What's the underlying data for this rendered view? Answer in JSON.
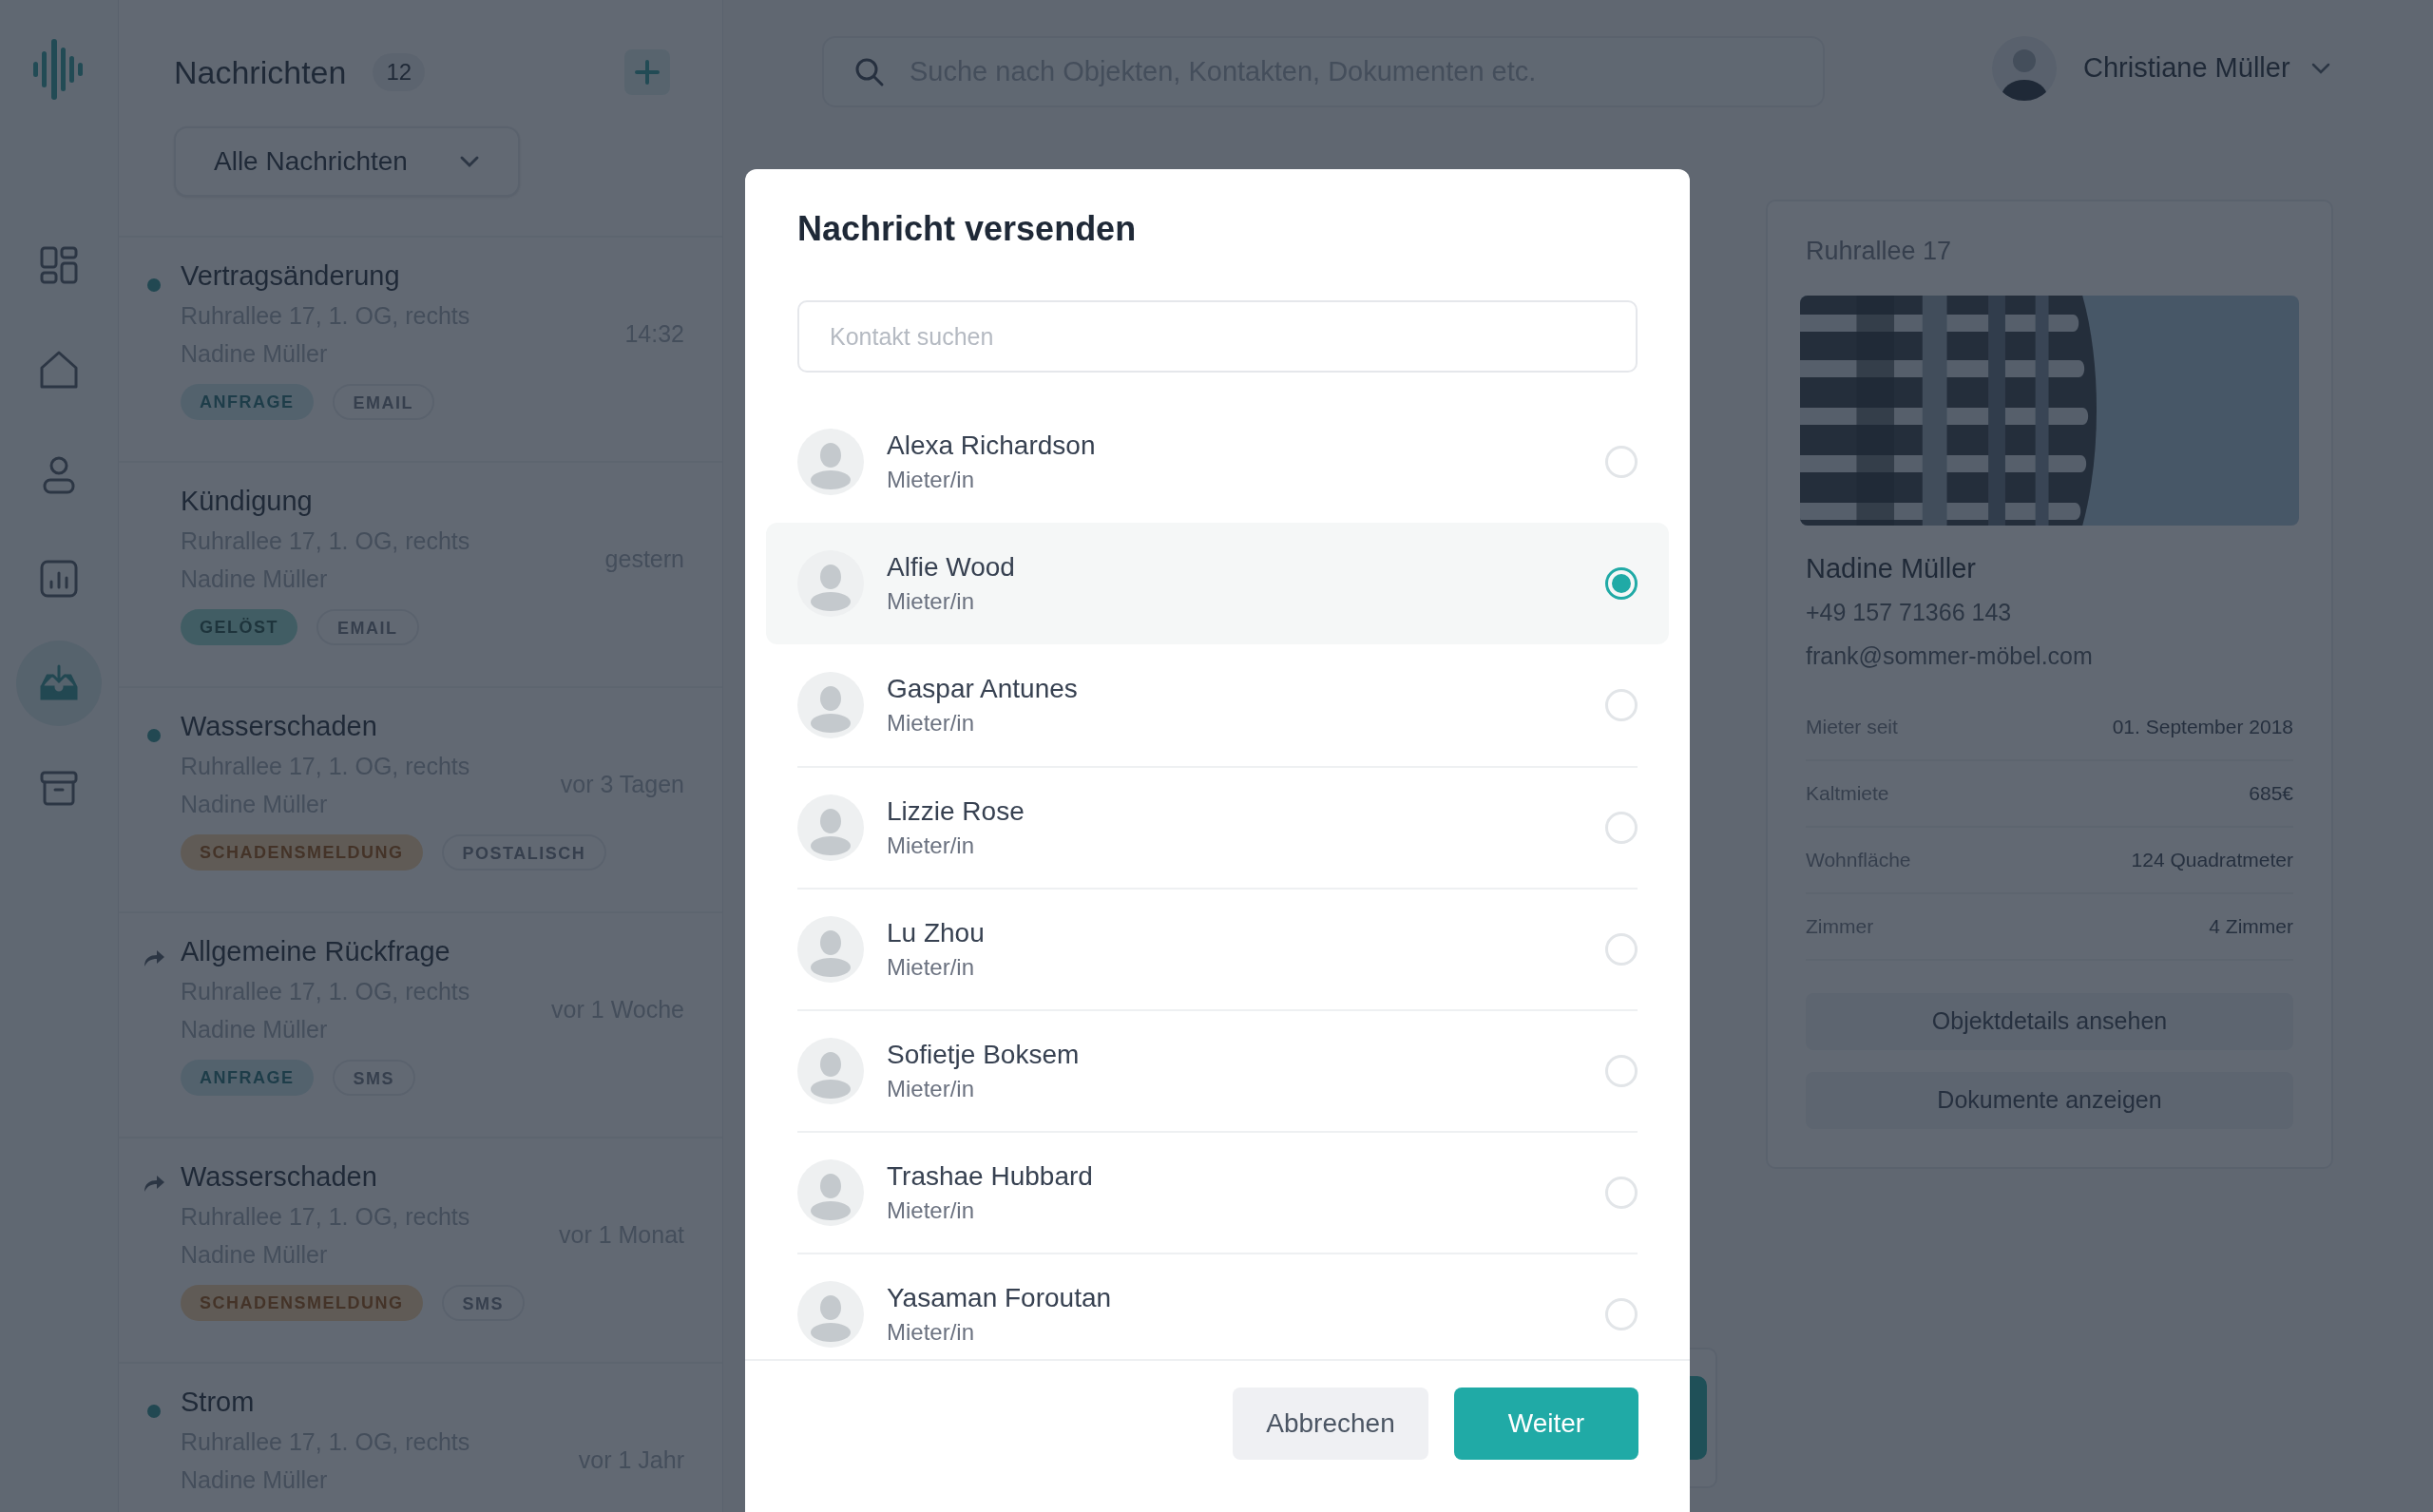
{
  "nav": {
    "items": [
      {
        "selected": false
      },
      {
        "selected": false
      },
      {
        "selected": false
      },
      {
        "selected": false
      },
      {
        "selected": true
      },
      {
        "selected": false
      }
    ]
  },
  "messages": {
    "title": "Nachrichten",
    "count": "12",
    "filter": "Alle Nachrichten",
    "items": [
      {
        "kind": "unread",
        "title": "Vertragsänderung",
        "address": "Ruhrallee 17, 1. OG, rechts",
        "contact": "Nadine Müller",
        "time": "14:32",
        "tags": [
          {
            "kind": "info",
            "label": "ANFRAGE"
          },
          {
            "kind": "channel",
            "label": "EMAIL"
          }
        ]
      },
      {
        "kind": "read",
        "title": "Kündigung",
        "address": "Ruhrallee 17, 1. OG, rechts",
        "contact": "Nadine Müller",
        "time": "gestern",
        "tags": [
          {
            "kind": "success",
            "label": "GELÖST"
          },
          {
            "kind": "channel",
            "label": "EMAIL"
          }
        ]
      },
      {
        "kind": "unread",
        "title": "Wasserschaden",
        "address": "Ruhrallee 17, 1. OG, rechts",
        "contact": "Nadine Müller",
        "time": "vor 3 Tagen",
        "tags": [
          {
            "kind": "warning",
            "label": "SCHADENSMELDUNG"
          },
          {
            "kind": "channel",
            "label": "POSTALISCH"
          }
        ]
      },
      {
        "kind": "forwarded",
        "title": "Allgemeine Rückfrage",
        "address": "Ruhrallee 17, 1. OG, rechts",
        "contact": "Nadine Müller",
        "time": "vor 1 Woche",
        "tags": [
          {
            "kind": "info",
            "label": "ANFRAGE"
          },
          {
            "kind": "channel",
            "label": "SMS"
          }
        ]
      },
      {
        "kind": "forwarded",
        "title": "Wasserschaden",
        "address": "Ruhrallee 17, 1. OG, rechts",
        "contact": "Nadine Müller",
        "time": "vor 1 Monat",
        "tags": [
          {
            "kind": "warning",
            "label": "SCHADENSMELDUNG"
          },
          {
            "kind": "channel",
            "label": "SMS"
          }
        ]
      },
      {
        "kind": "unread",
        "title": "Strom",
        "address": "Ruhrallee 17, 1. OG, rechts",
        "contact": "Nadine Müller",
        "time": "vor 1 Jahr"
      }
    ]
  },
  "search": {
    "placeholder": "Suche nach Objekten, Kontakten, Dokumenten etc."
  },
  "user": {
    "name": "Christiane Müller"
  },
  "property_card": {
    "title": "Ruhrallee 17",
    "name": "Nadine Müller",
    "phone": "+49 157 71366 143",
    "email": "frank@sommer-möbel.com",
    "details": [
      {
        "label": "Mieter seit",
        "value": "01. September 2018"
      },
      {
        "label": "Kaltmiete",
        "value": "685€"
      },
      {
        "label": "Wohnfläche",
        "value": "124 Quadratmeter"
      },
      {
        "label": "Zimmer",
        "value": "4 Zimmer"
      }
    ],
    "buttons": [
      "Objektdetails ansehen",
      "Dokumente anzeigen"
    ]
  },
  "dialog": {
    "title": "Nachricht versenden",
    "search_placeholder": "Kontakt suchen",
    "contacts": [
      {
        "name": "Alexa Richardson",
        "role": "Mieter/in",
        "selected": false
      },
      {
        "name": "Alfie Wood",
        "role": "Mieter/in",
        "selected": true
      },
      {
        "name": "Gaspar Antunes",
        "role": "Mieter/in",
        "selected": false
      },
      {
        "name": "Lizzie Rose",
        "role": "Mieter/in",
        "selected": false
      },
      {
        "name": "Lu Zhou",
        "role": "Mieter/in",
        "selected": false
      },
      {
        "name": "Sofietje Boksem",
        "role": "Mieter/in",
        "selected": false
      },
      {
        "name": "Trashae Hubbard",
        "role": "Mieter/in",
        "selected": false
      },
      {
        "name": "Yasaman Foroutan",
        "role": "Mieter/in",
        "selected": false
      }
    ],
    "buttons": [
      {
        "label": "Abbrechen",
        "kind": "secondary"
      },
      {
        "label": "Weiter",
        "kind": "primary"
      }
    ]
  }
}
